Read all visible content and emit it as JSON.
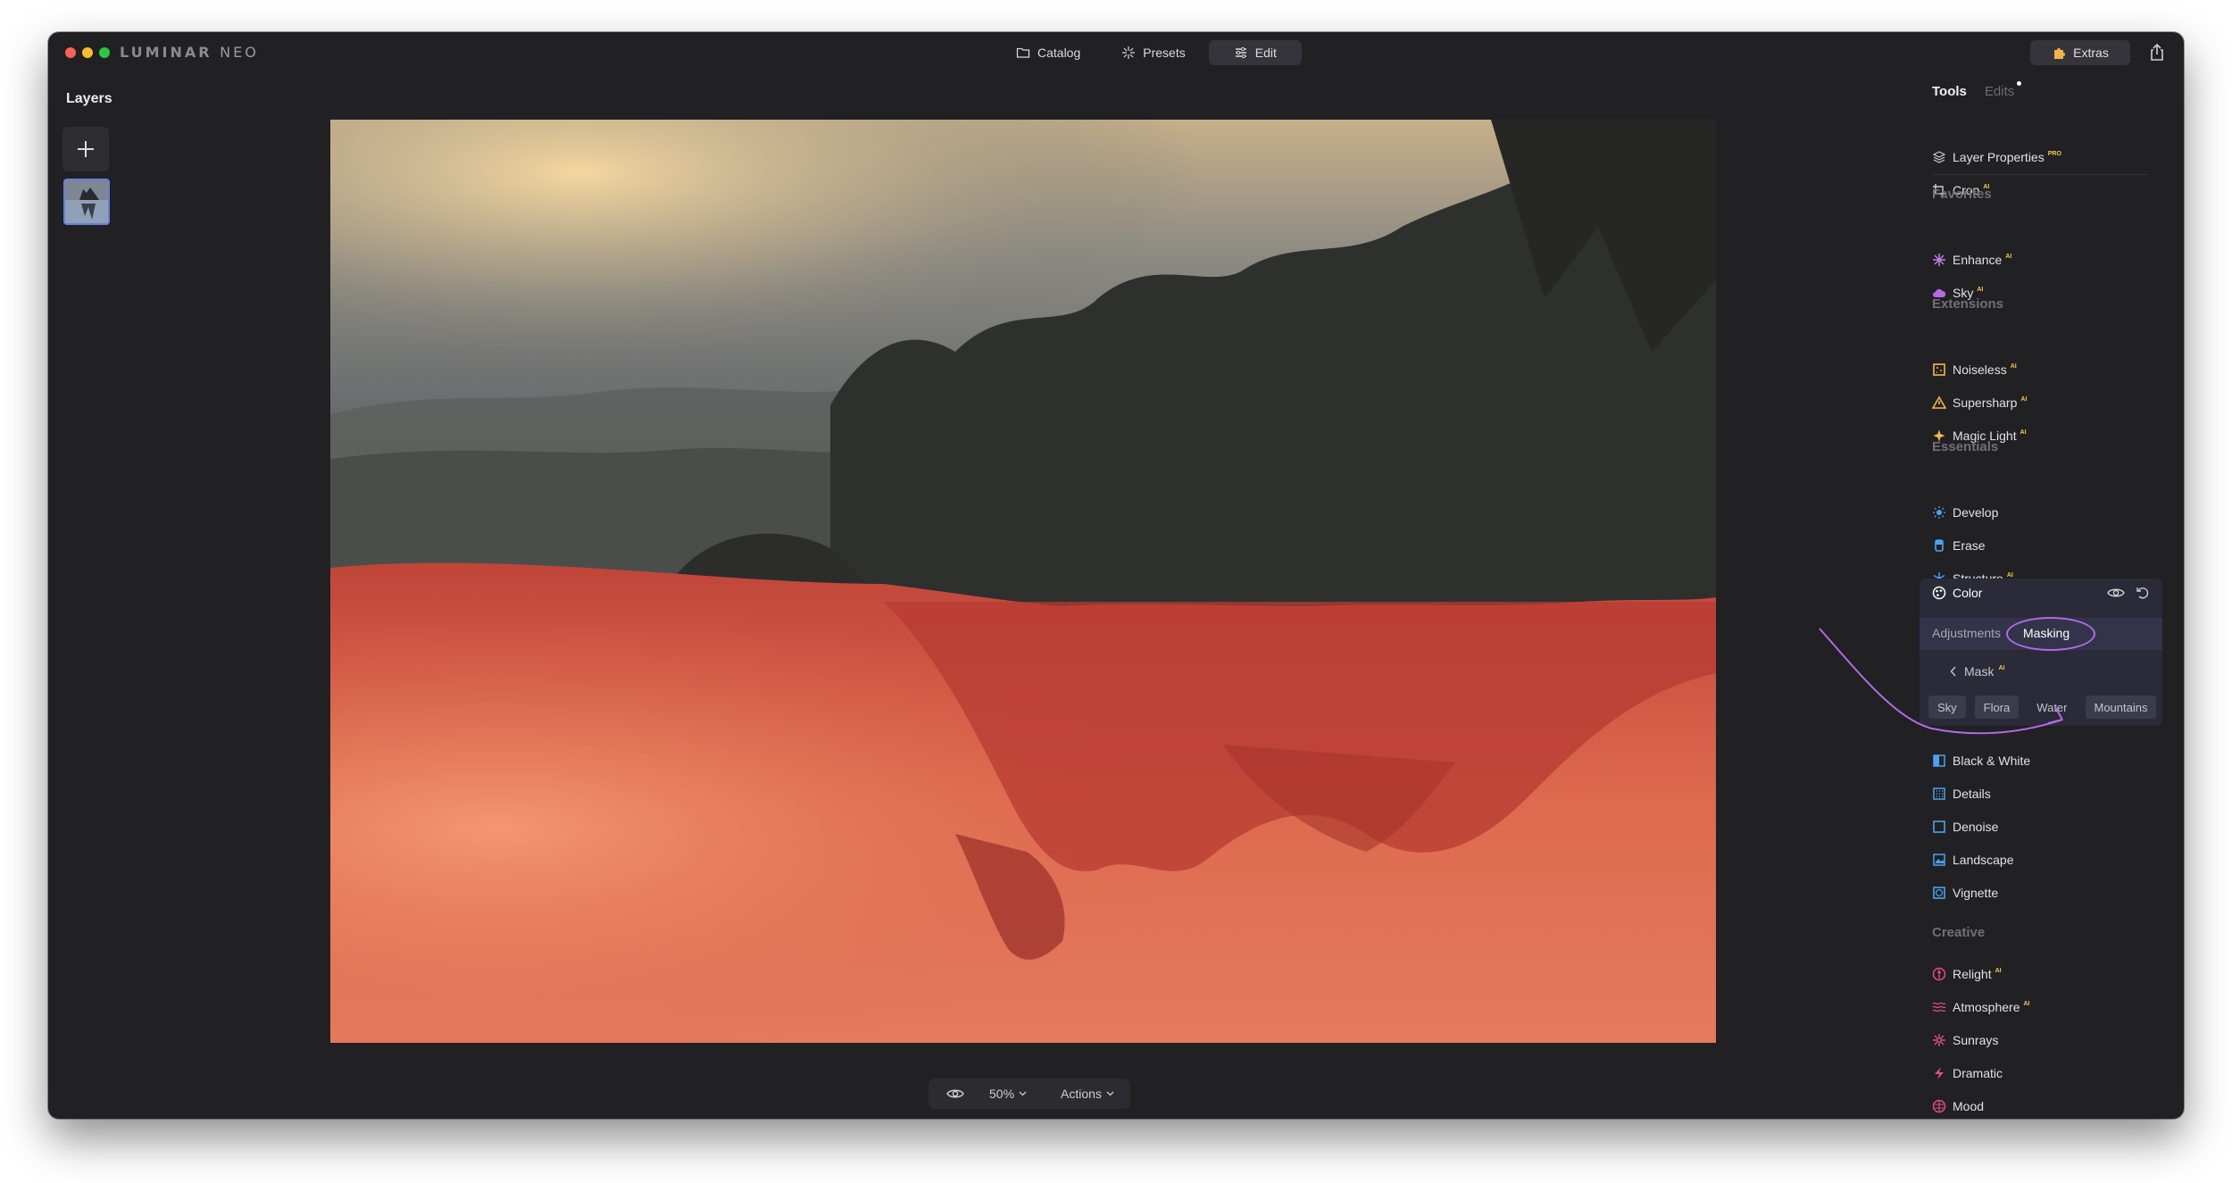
{
  "app": {
    "logo_main": "LUMINAR",
    "logo_sub": "NEO"
  },
  "topnav": [
    {
      "label": "Catalog",
      "icon": "folder-icon"
    },
    {
      "label": "Presets",
      "icon": "sparkle-icon"
    },
    {
      "label": "Edit",
      "icon": "sliders-icon",
      "active": true
    }
  ],
  "extras": {
    "label": "Extras",
    "icon": "puzzle-icon"
  },
  "layers": {
    "title": "Layers"
  },
  "bottombar": {
    "zoom": "50%",
    "actions": "Actions"
  },
  "tools_panel": {
    "tabs": [
      {
        "label": "Tools",
        "active": true
      },
      {
        "label": "Edits",
        "has_dot": true
      }
    ],
    "top_tools": [
      {
        "label": "Layer Properties",
        "badge": "PRO",
        "icon": "layers-icon"
      },
      {
        "label": "Crop",
        "badge": "AI",
        "icon": "crop-icon"
      }
    ],
    "favorites": {
      "title": "Favorites",
      "items": [
        {
          "label": "Enhance",
          "badge": "AI",
          "icon": "enhance-icon"
        },
        {
          "label": "Sky",
          "badge": "AI",
          "icon": "cloud-icon"
        }
      ]
    },
    "extensions": {
      "title": "Extensions",
      "items": [
        {
          "label": "Noiseless",
          "badge": "AI",
          "icon": "noiseless-icon"
        },
        {
          "label": "Supersharp",
          "badge": "AI",
          "icon": "triangle-icon"
        },
        {
          "label": "Magic Light",
          "badge": "AI",
          "icon": "starburst-icon"
        }
      ]
    },
    "essentials": {
      "title": "Essentials",
      "items": [
        {
          "label": "Develop",
          "icon": "sun-icon"
        },
        {
          "label": "Erase",
          "icon": "eraser-icon"
        },
        {
          "label": "Structure",
          "badge": "AI",
          "icon": "structure-icon"
        }
      ]
    },
    "color_tool": {
      "label": "Color",
      "tabs": {
        "adjustments": "Adjustments",
        "masking": "Masking"
      },
      "mask_label": "Mask",
      "mask_badge": "AI",
      "chips": [
        "Sky",
        "Flora",
        "Water",
        "Mountains"
      ],
      "selected_chip": "Water"
    },
    "after_color": [
      {
        "label": "Black & White",
        "icon": "bw-icon"
      },
      {
        "label": "Details",
        "icon": "details-icon"
      },
      {
        "label": "Denoise",
        "icon": "denoise-icon"
      },
      {
        "label": "Landscape",
        "icon": "landscape-icon"
      },
      {
        "label": "Vignette",
        "icon": "vignette-icon"
      }
    ],
    "creative": {
      "title": "Creative",
      "items": [
        {
          "label": "Relight",
          "badge": "AI",
          "icon": "relight-icon"
        },
        {
          "label": "Atmosphere",
          "badge": "AI",
          "icon": "atmosphere-icon"
        },
        {
          "label": "Sunrays",
          "icon": "sunrays-icon"
        },
        {
          "label": "Dramatic",
          "icon": "bolt-icon"
        },
        {
          "label": "Mood",
          "icon": "mood-icon"
        }
      ]
    }
  },
  "colors": {
    "mask_overlay": "#e0543e",
    "accent": "#b36ae6",
    "panel": "#212023"
  }
}
